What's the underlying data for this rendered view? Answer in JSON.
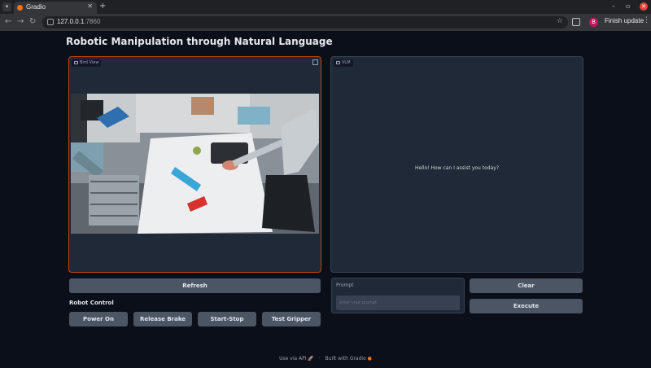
{
  "browser": {
    "tab_title": "Gradio",
    "url_host": "127.0.0.1",
    "url_port": ":7860",
    "update_button": "Finish update",
    "profile_initial": "B"
  },
  "page": {
    "title": "Robotic Manipulation through Natural Language"
  },
  "bird_view": {
    "label": "Bird View"
  },
  "vlm": {
    "label": "VLM",
    "messages": [
      "Hello! How can I assist you today?"
    ]
  },
  "controls": {
    "refresh": "Refresh",
    "section_label": "Robot Control",
    "power_on": "Power On",
    "release_brake": "Release Brake",
    "start_stop": "Start-Stop",
    "test_gripper": "Test Gripper"
  },
  "prompt": {
    "label": "Prompt",
    "placeholder": "enter your prompt",
    "clear": "Clear",
    "execute": "Execute"
  },
  "footer": {
    "api": "Use via API",
    "built": "Built with Gradio"
  },
  "colors": {
    "background": "#0b0f19",
    "panel": "#1f2937",
    "button": "#4b5563",
    "active_border": "#c2410c"
  }
}
